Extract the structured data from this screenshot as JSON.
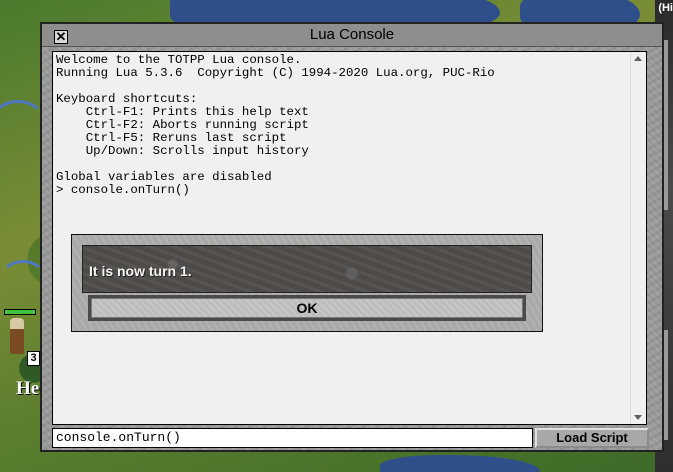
{
  "window": {
    "title": "Lua Console",
    "close_glyph": "✕"
  },
  "console_output": [
    "Welcome to the TOTPP Lua console.",
    "Running Lua 5.3.6  Copyright (C) 1994-2020 Lua.org, PUC-Rio",
    "",
    "Keyboard shortcuts:",
    "    Ctrl-F1: Prints this help text",
    "    Ctrl-F2: Aborts running script",
    "    Ctrl-F5: Reruns last script",
    "    Up/Down: Scrolls input history",
    "",
    "Global variables are disabled",
    "> console.onTurn()"
  ],
  "input": {
    "value": "console.onTurn()"
  },
  "load_button": {
    "label": "Load Script"
  },
  "dialog": {
    "message": "It is now turn 1.",
    "ok_label": "OK"
  },
  "map": {
    "city_label": "He",
    "unit_badge": "3",
    "corner_label": "(Hi"
  },
  "icons": {
    "close": "close-icon",
    "scroll_up": "arrow-up-icon",
    "scroll_down": "arrow-down-icon"
  }
}
